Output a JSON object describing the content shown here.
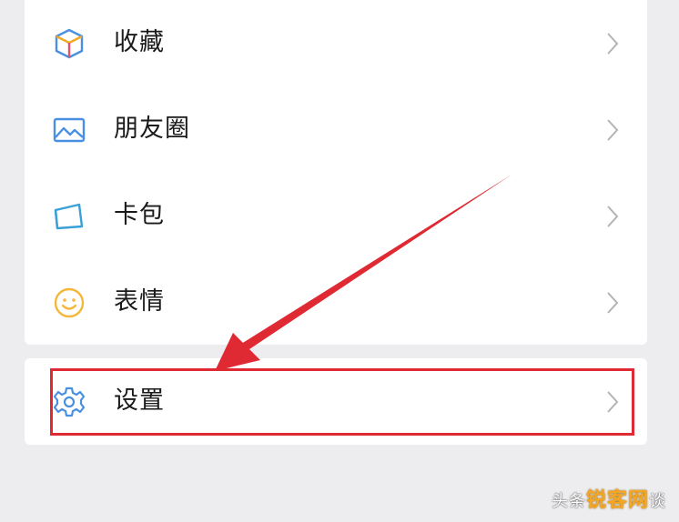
{
  "menu": {
    "items": [
      {
        "label": "收藏",
        "icon": "favorites-cube-icon"
      },
      {
        "label": "朋友圈",
        "icon": "moments-picture-icon"
      },
      {
        "label": "卡包",
        "icon": "card-wallet-icon"
      },
      {
        "label": "表情",
        "icon": "sticker-smiley-icon"
      }
    ],
    "settings": {
      "label": "设置",
      "icon": "gear-icon"
    }
  },
  "annotation": {
    "highlight_color": "#e02a33"
  },
  "watermark": {
    "prefix": "头条",
    "brand": "锐客网",
    "suffix": "谈"
  }
}
